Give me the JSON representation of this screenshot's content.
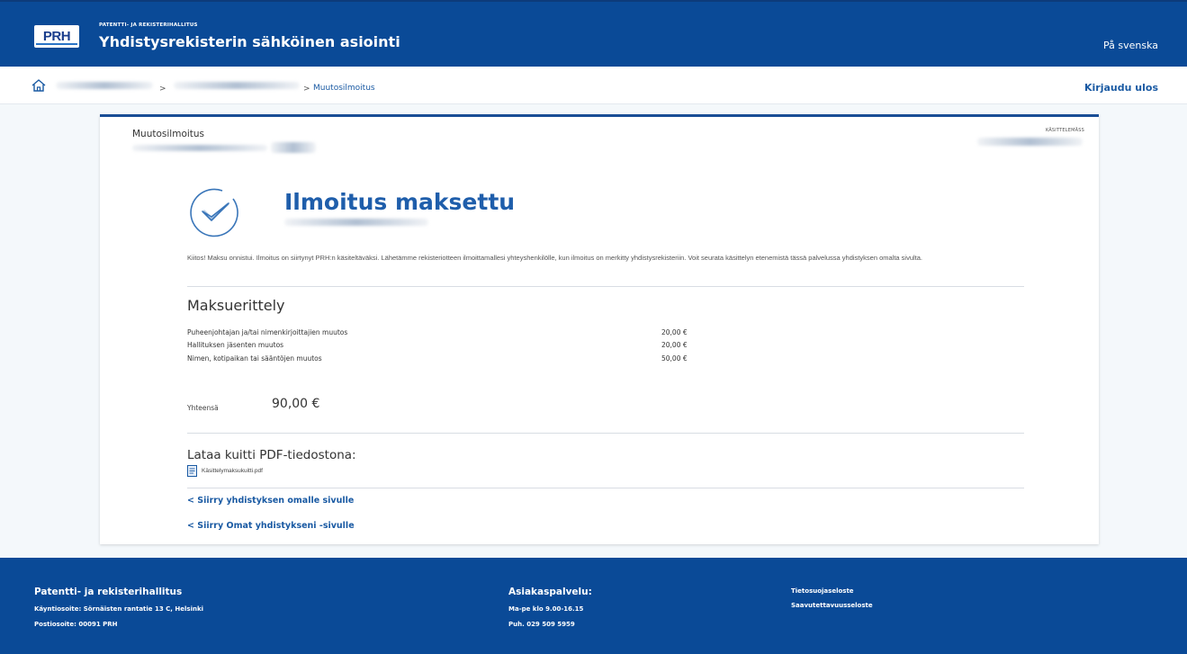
{
  "header": {
    "logo_text": "PRH",
    "org_name_small": "Patentti- ja rekisterihallitus",
    "service_title": "Yhdistysrekisterin sähköinen asiointi",
    "language_link": "På svenska"
  },
  "breadcrumb": {
    "separator_1": ">",
    "separator_2": ">",
    "current": "Muutosilmoitus",
    "logout": "Kirjaudu ulos"
  },
  "card": {
    "title": "Muutosilmoitus",
    "tag": "KÄSITTELEMÄSS",
    "heading": "Ilmoitus maksettu",
    "info_text": "Kiitos! Maksu onnistui. Ilmoitus on siirtynyt PRH:n käsiteltäväksi. Lähetämme rekisteriotteen ilmoittamallesi yhteyshenkilölle, kun ilmoitus on merkitty yhdistysrekisteriin. Voit seurata käsittelyn etenemistä tässä palvelussa yhdistyksen omalta sivulta.",
    "breakdown_title": "Maksuerittely",
    "fees": [
      {
        "label": "Puheenjohtajan ja/tai nimenkirjoittajien muutos",
        "amount": "20,00 €"
      },
      {
        "label": "Hallituksen jäsenten muutos",
        "amount": "20,00 €"
      },
      {
        "label": "Nimen, kotipaikan tai sääntöjen muutos",
        "amount": "50,00 €"
      }
    ],
    "total_label": "Yhteensä",
    "total_value": "90,00 €",
    "pdf_title": "Lataa kuitti PDF-tiedostona:",
    "pdf_file": "Käsittelymaksukuitti.pdf",
    "link_association": "< Siirry yhdistyksen omalle sivulle",
    "link_my_associations": "< Siirry Omat yhdistykseni -sivulle"
  },
  "footer": {
    "org_name": "Patentti- ja rekisterihallitus",
    "visit_address": "Käyntiosoite: Sörnäisten rantatie 13 C, Helsinki",
    "postal_address": "Postiosoite: 00091 PRH",
    "service_title": "Asiakaspalvelu:",
    "service_hours": "Ma-pe klo 9.00-16.15",
    "service_phone": "Puh. 029 509 5959",
    "privacy_link": "Tietosuojaseloste",
    "accessibility_link": "Saavutettavuusseloste"
  },
  "colors": {
    "brand_blue": "#0a4a97",
    "heading_blue": "#1f5eab",
    "link_blue": "#1a5aa3"
  }
}
